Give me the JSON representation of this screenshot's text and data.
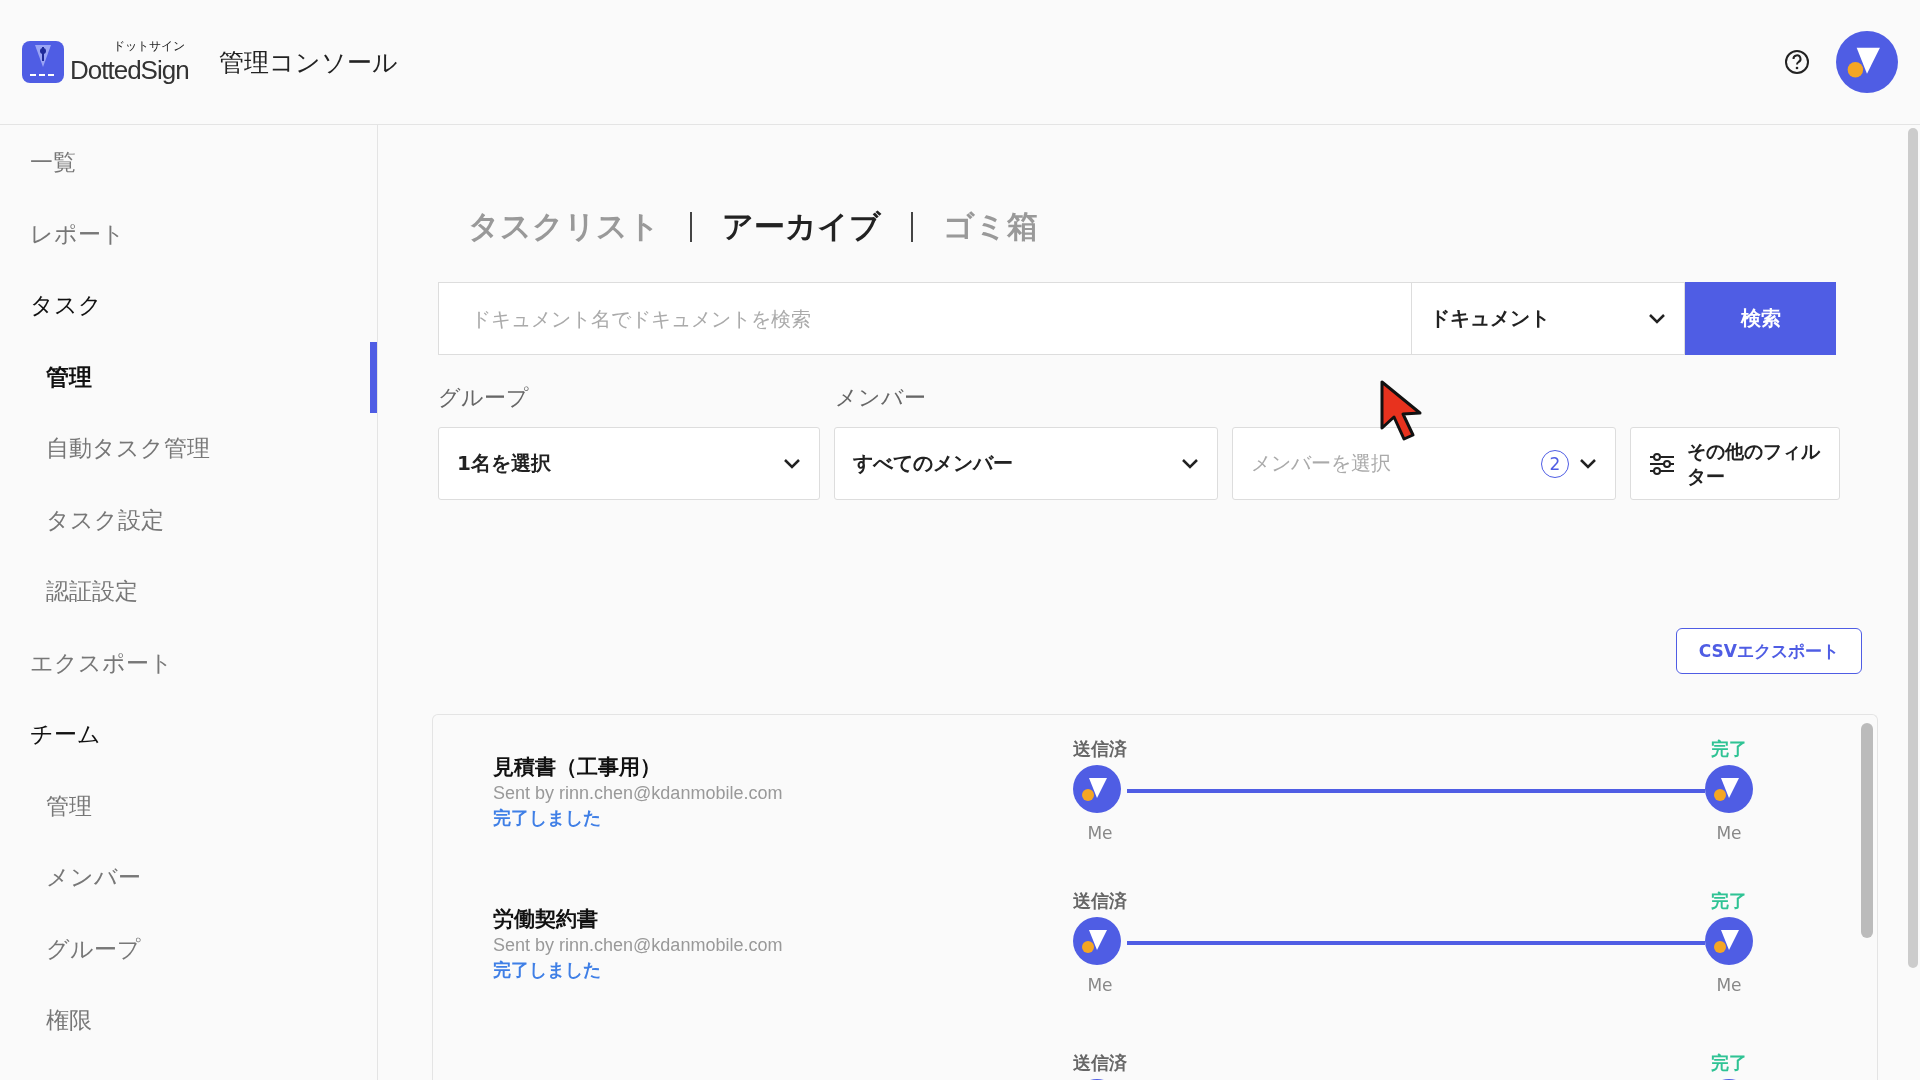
{
  "header": {
    "brand_kana": "ドットサイン",
    "brand": "DottedSign",
    "title": "管理コンソール"
  },
  "sidebar": {
    "items": [
      {
        "label": "一覧",
        "selected": false
      },
      {
        "label": "レポート",
        "selected": false
      },
      {
        "label": "タスク",
        "selected": false,
        "children": [
          {
            "label": "管理",
            "selected": true
          },
          {
            "label": "自動タスク管理",
            "selected": false
          },
          {
            "label": "タスク設定",
            "selected": false
          },
          {
            "label": "認証設定",
            "selected": false
          }
        ]
      },
      {
        "label": "エクスポート",
        "selected": false
      },
      {
        "label": "チーム",
        "selected": false,
        "children": [
          {
            "label": "管理",
            "selected": false
          },
          {
            "label": "メンバー",
            "selected": false
          },
          {
            "label": "グループ",
            "selected": false
          },
          {
            "label": "権限",
            "selected": false
          }
        ]
      }
    ]
  },
  "tabs": [
    {
      "label": "タスクリスト",
      "selected": false
    },
    {
      "label": "アーカイブ",
      "selected": true
    },
    {
      "label": "ゴミ箱",
      "selected": false
    }
  ],
  "search": {
    "placeholder": "ドキュメント名でドキュメントを検索",
    "scope": "ドキュメント",
    "button": "検索"
  },
  "filters": {
    "group_label": "グループ",
    "group_value": "1名を選択",
    "member_label": "メンバー",
    "member_value": "すべてのメンバー",
    "member_select_placeholder": "メンバーを選択",
    "member_count": "2",
    "more_filters": "その他のフィルター"
  },
  "export_button": "CSVエクスポート",
  "tasks": [
    {
      "title": "見積書（工事用）",
      "sender": "Sent by rinn.chen@kdanmobile.com",
      "status": "完了しました",
      "start_label": "送信済",
      "end_label": "完了",
      "start_name": "Me",
      "end_name": "Me"
    },
    {
      "title": "労働契約書",
      "sender": "Sent by rinn.chen@kdanmobile.com",
      "status": "完了しました",
      "start_label": "送信済",
      "end_label": "完了",
      "start_name": "Me",
      "end_name": "Me"
    },
    {
      "start_label": "送信済",
      "end_label": "完了"
    }
  ]
}
